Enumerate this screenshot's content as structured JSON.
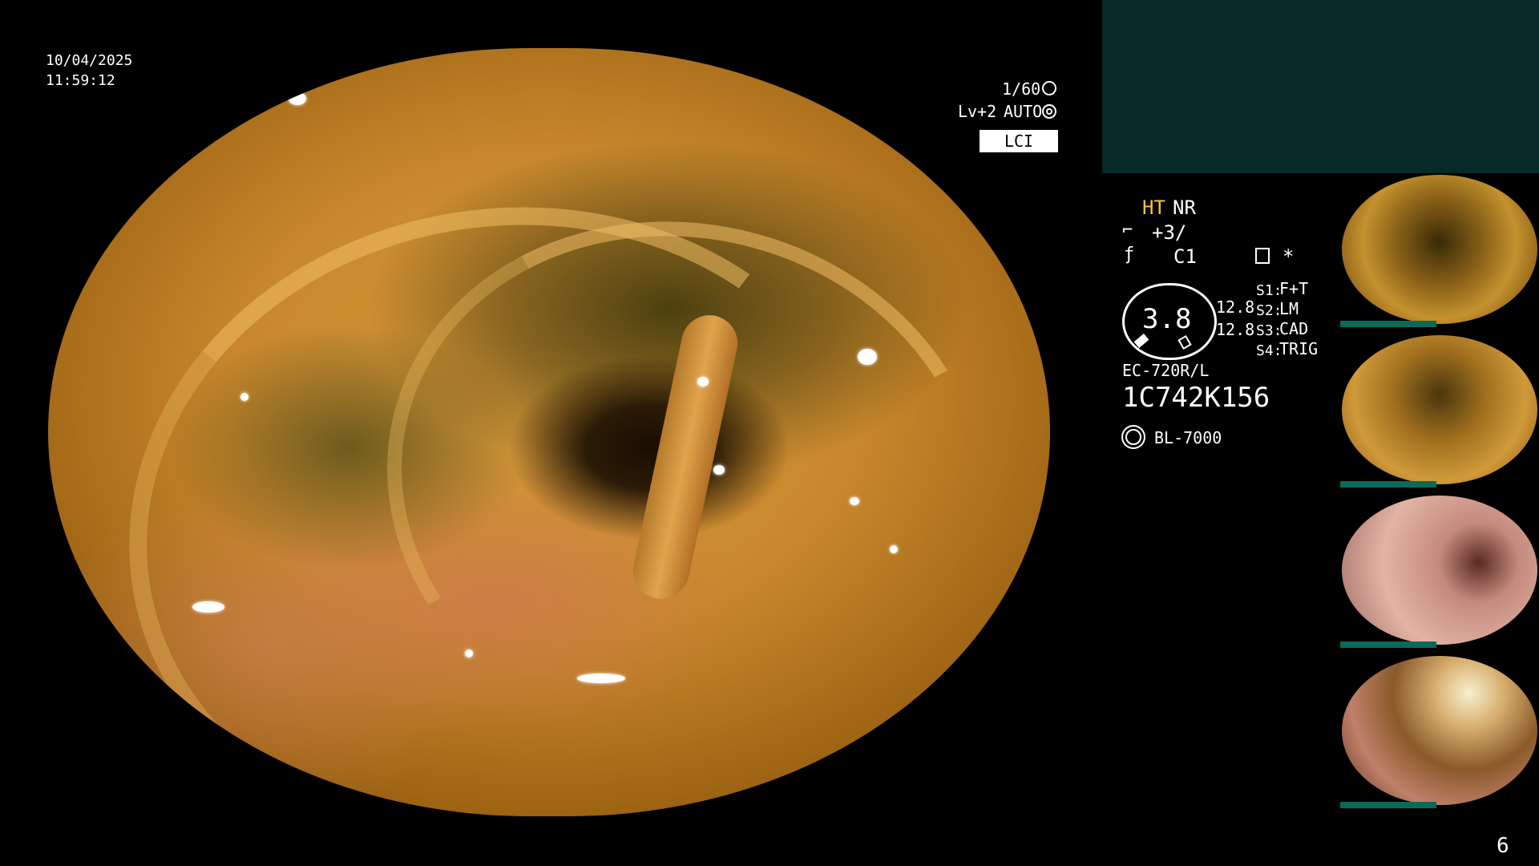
{
  "datetime": {
    "date": "10/04/2025",
    "time": "11:59:12"
  },
  "camera": {
    "shutter": "1/60",
    "shutter_icon": "aperture-icon",
    "level": "Lv+2",
    "exposure_mode": "AUTO",
    "exposure_icon": "iris-icon",
    "imaging_mode": "LCI"
  },
  "settings": {
    "ht": "HT",
    "nr": "NR",
    "enhance": "+3/",
    "color": "C1",
    "star": "*",
    "gauge_value": "3.8",
    "gauge_side_top": "12.8",
    "gauge_side_bottom": "12.8",
    "switches": [
      {
        "key": "S1:",
        "value": "F+T"
      },
      {
        "key": "S2:",
        "value": "LM"
      },
      {
        "key": "S3:",
        "value": "CAD"
      },
      {
        "key": "S4:",
        "value": "TRIG"
      }
    ]
  },
  "scope": {
    "model": "EC-720R/L",
    "serial": "1C742K156",
    "light_source": "BL-7000"
  },
  "image_counter": "6",
  "colors": {
    "panel": "#052a28",
    "accent": "#f5c14a",
    "thumb_bar": "#0a6a5a"
  }
}
